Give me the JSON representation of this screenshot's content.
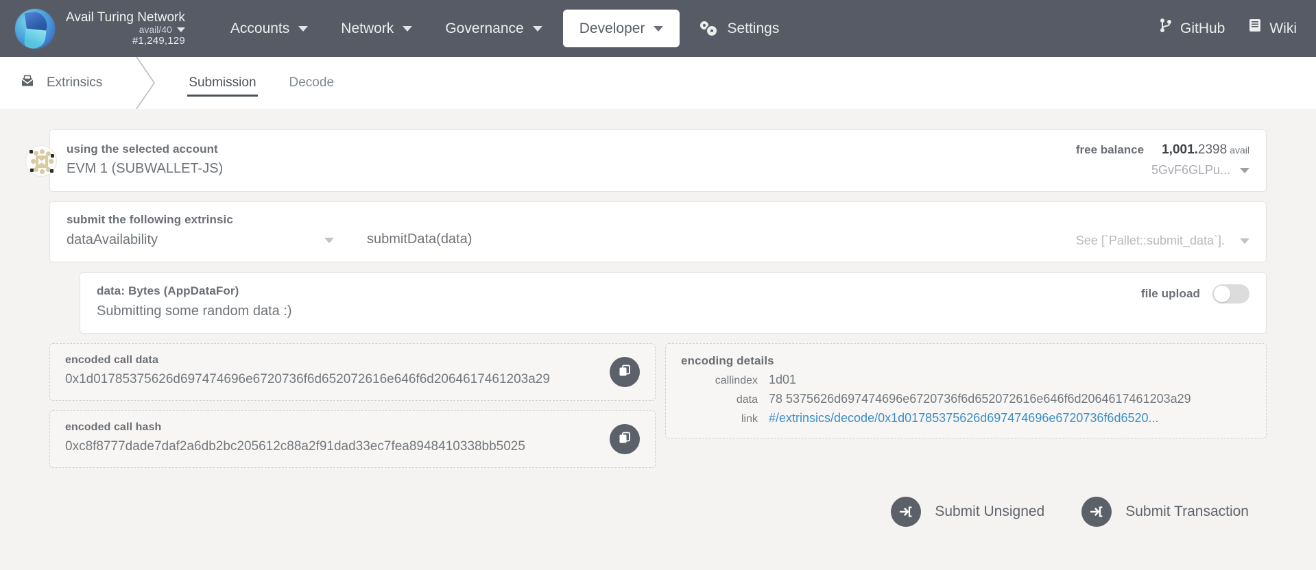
{
  "topbar": {
    "brand": {
      "logo_icon": "avail-logo-icon",
      "name": "Avail Turing Network",
      "version": "avail/40",
      "block": "#1,249,129"
    },
    "nav": [
      {
        "label": "Accounts",
        "caret": true,
        "active": false
      },
      {
        "label": "Network",
        "caret": true,
        "active": false
      },
      {
        "label": "Governance",
        "caret": true,
        "active": false
      },
      {
        "label": "Developer",
        "caret": true,
        "active": true
      }
    ],
    "settings": {
      "label": "Settings",
      "icon": "gear-icon"
    },
    "right": [
      {
        "label": "GitHub",
        "icon": "code-branch-icon"
      },
      {
        "label": "Wiki",
        "icon": "book-icon"
      }
    ]
  },
  "subbar": {
    "breadcrumb": {
      "label": "Extrinsics",
      "icon": "envelope-icon"
    },
    "tabs": [
      {
        "label": "Submission",
        "active": true
      },
      {
        "label": "Decode",
        "active": false
      }
    ]
  },
  "account": {
    "label": "using the selected account",
    "value": "EVM 1 (SUBWALLET-JS)",
    "balance_label": "free balance",
    "balance_int": "1,001.",
    "balance_dec": "2398",
    "balance_unit": "avail",
    "address": "5GvF6GLPu...",
    "identicon": "polkadot-identicon"
  },
  "extrinsic": {
    "label": "submit the following extrinsic",
    "pallet": "dataAvailability",
    "method": "submitData(data)",
    "docs": "See [`Pallet::submit_data`]."
  },
  "param": {
    "label": "data: Bytes (AppDataFor)",
    "value": "Submitting some random data :)",
    "file_upload_label": "file upload",
    "file_upload_on": false
  },
  "encoded": {
    "call_data_label": "encoded call data",
    "call_data": "0x1d01785375626d697474696e6720736f6d652072616e646f6d2064617461203a29",
    "call_hash_label": "encoded call hash",
    "call_hash": "0xc8f8777dade7daf2a6db2bc205612c88a2f91dad33ec7fea8948410338bb5025",
    "copy_icon": "copy-icon"
  },
  "encoding_details": {
    "title": "encoding details",
    "rows": [
      {
        "key": "callindex",
        "value": "1d01",
        "link": false
      },
      {
        "key": "data",
        "value": "78  5375626d697474696e6720736f6d652072616e646f6d2064617461203a29",
        "link": false
      },
      {
        "key": "link",
        "value": "#/extrinsics/decode/0x1d01785375626d697474696e6720736f6d6520...",
        "link": true
      }
    ]
  },
  "actions": [
    {
      "label": "Submit Unsigned",
      "icon": "sign-in-icon"
    },
    {
      "label": "Submit Transaction",
      "icon": "sign-in-icon"
    }
  ],
  "colors": {
    "topbar_bg": "#565b66",
    "page_bg": "#f4f3f1",
    "link": "#3d8fc6",
    "button": "#5c6068"
  }
}
